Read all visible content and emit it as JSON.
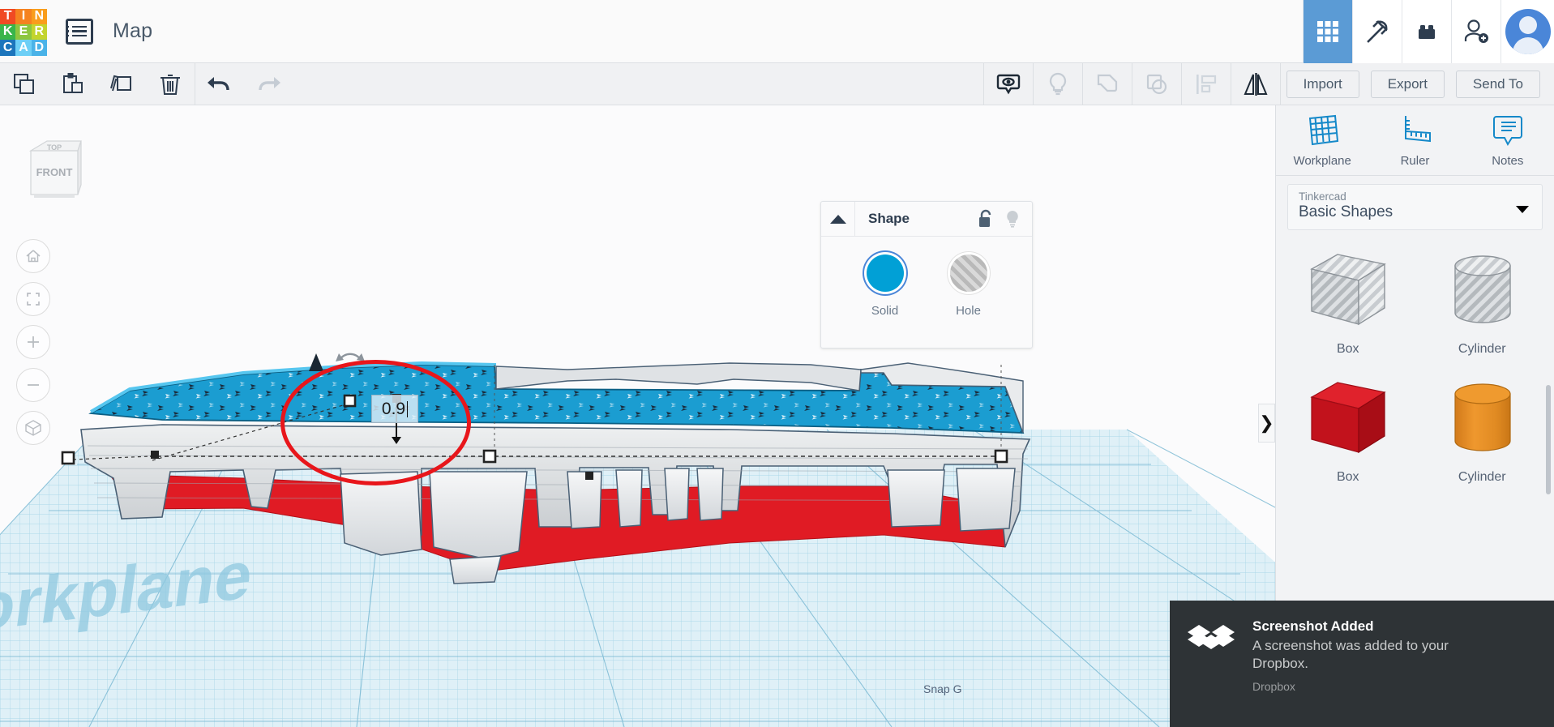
{
  "app": {
    "logo_letters": [
      {
        "ch": "T",
        "color": "#f04a23"
      },
      {
        "ch": "I",
        "color": "#f58220"
      },
      {
        "ch": "N",
        "color": "#f99d1c"
      },
      {
        "ch": "K",
        "color": "#39b54a"
      },
      {
        "ch": "E",
        "color": "#8dc63f"
      },
      {
        "ch": "R",
        "color": "#c3d42e"
      },
      {
        "ch": "C",
        "color": "#1c75bc"
      },
      {
        "ch": "A",
        "color": "#6dcff6"
      },
      {
        "ch": "D",
        "color": "#4ab3e8"
      }
    ],
    "document_title": "Map",
    "menu_icon": "list-menu-icon"
  },
  "topbar": {
    "icons": [
      {
        "name": "grid-apps-icon",
        "label": "Design",
        "active": true
      },
      {
        "name": "pickaxe-icon",
        "label": "Blocks",
        "active": false
      },
      {
        "name": "lego-brick-icon",
        "label": "Bricks",
        "active": false
      },
      {
        "name": "add-person-icon",
        "label": "Invite",
        "active": false
      }
    ],
    "avatar": "user-avatar"
  },
  "toolbar": {
    "left_tools": [
      {
        "name": "copy-icon",
        "label": "Copy",
        "enabled": true
      },
      {
        "name": "paste-icon",
        "label": "Paste",
        "enabled": true
      },
      {
        "name": "duplicate-icon",
        "label": "Duplicate",
        "enabled": true
      },
      {
        "name": "delete-icon",
        "label": "Delete",
        "enabled": true
      },
      {
        "name": "undo-icon",
        "label": "Undo",
        "enabled": true
      },
      {
        "name": "redo-icon",
        "label": "Redo",
        "enabled": false
      }
    ],
    "right_tools": [
      {
        "name": "visibility-icon",
        "label": "Show / Hide",
        "enabled": true
      },
      {
        "name": "lightbulb-icon",
        "label": "Highlight",
        "enabled": false
      },
      {
        "name": "group-icon",
        "label": "Group",
        "enabled": false
      },
      {
        "name": "ungroup-icon",
        "label": "Ungroup",
        "enabled": false
      },
      {
        "name": "align-icon",
        "label": "Align",
        "enabled": false
      },
      {
        "name": "mirror-icon",
        "label": "Mirror",
        "enabled": true
      }
    ],
    "buttons": [
      {
        "name": "import-button",
        "label": "Import"
      },
      {
        "name": "export-button",
        "label": "Export"
      },
      {
        "name": "send-to-button",
        "label": "Send To"
      }
    ]
  },
  "canvas": {
    "view_cube_front": "FRONT",
    "view_cube_top": "TOP",
    "nav_buttons": [
      {
        "name": "home-view-button",
        "icon": "home-icon"
      },
      {
        "name": "fit-to-view-button",
        "icon": "fit-frame-icon"
      },
      {
        "name": "zoom-in-button",
        "icon": "plus-icon"
      },
      {
        "name": "zoom-out-button",
        "icon": "minus-icon"
      },
      {
        "name": "ortho-perspective-button",
        "icon": "cube-icon"
      }
    ],
    "dimension_value": "0.9",
    "workplane_watermark": "Workplane",
    "snap_grid_label": "Snap G",
    "panel_toggle": "❯",
    "colors": {
      "grid": "#a6d8ea",
      "model_blue": "#1b9dd1",
      "model_red": "#e01b24",
      "model_gray": "#c6c9cc",
      "annotation": "#e8161b"
    }
  },
  "shape_panel": {
    "title": "Shape",
    "collapse_icon": "triangle-up-icon",
    "lock_icon": "unlock-icon",
    "light_icon": "lightbulb-icon",
    "swatches": [
      {
        "name": "solid-swatch",
        "label": "Solid",
        "selected": true,
        "color": "#01a0d6"
      },
      {
        "name": "hole-swatch",
        "label": "Hole",
        "selected": false,
        "color": "#c2c2c2"
      }
    ]
  },
  "right_panel": {
    "tools": [
      {
        "name": "workplane-tool",
        "label": "Workplane",
        "icon": "workplane-grid-icon"
      },
      {
        "name": "ruler-tool",
        "label": "Ruler",
        "icon": "ruler-icon"
      },
      {
        "name": "notes-tool",
        "label": "Notes",
        "icon": "notes-bubble-icon"
      }
    ],
    "library": {
      "group_label": "Tinkercad",
      "selected": "Basic Shapes"
    },
    "shapes": [
      {
        "name": "shape-box-hole",
        "label": "Box",
        "kind": "box",
        "style": "hole",
        "color": "#b8bcc0"
      },
      {
        "name": "shape-cylinder-hole",
        "label": "Cylinder",
        "kind": "cylinder",
        "style": "hole",
        "color": "#b8bcc0"
      },
      {
        "name": "shape-box-solid",
        "label": "Box",
        "kind": "box",
        "style": "solid",
        "color": "#d0121b"
      },
      {
        "name": "shape-cylinder-solid",
        "label": "Cylinder",
        "kind": "cylinder",
        "style": "solid",
        "color": "#e8912a"
      }
    ]
  },
  "notification": {
    "app_icon": "dropbox-icon",
    "title": "Screenshot Added",
    "body": "A screenshot was added to your Dropbox.",
    "source": "Dropbox"
  }
}
